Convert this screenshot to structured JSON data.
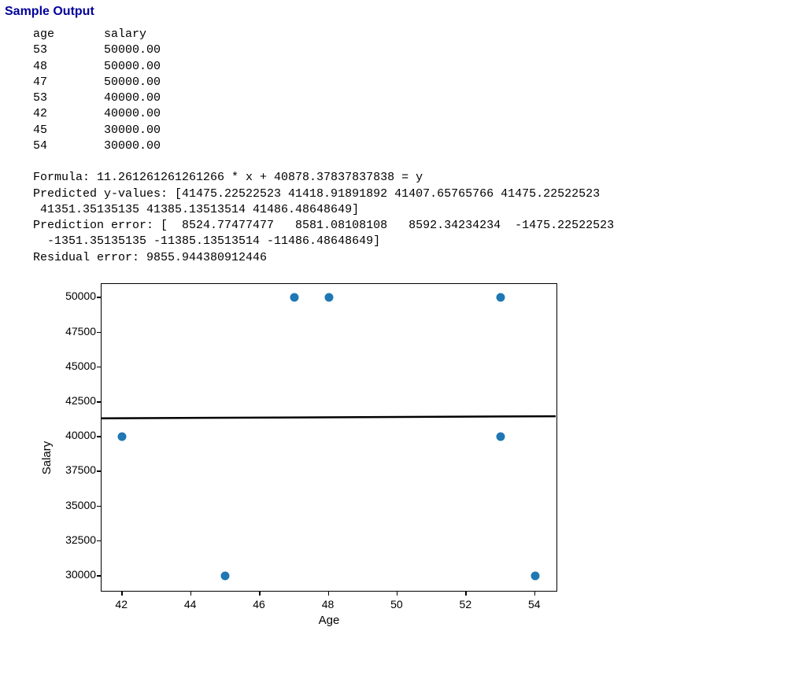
{
  "section_title": "Sample Output",
  "table": {
    "header": {
      "col1": "age",
      "col2": "salary"
    },
    "rows": [
      {
        "age": "53",
        "salary": "50000.00"
      },
      {
        "age": "48",
        "salary": "50000.00"
      },
      {
        "age": "47",
        "salary": "50000.00"
      },
      {
        "age": "53",
        "salary": "40000.00"
      },
      {
        "age": "42",
        "salary": "40000.00"
      },
      {
        "age": "45",
        "salary": "30000.00"
      },
      {
        "age": "54",
        "salary": "30000.00"
      }
    ]
  },
  "text": {
    "formula_line": "Formula: 11.261261261261266 * x + 40878.37837837838 = y",
    "predicted_line1": "Predicted y-values: [41475.22522523 41418.91891892 41407.65765766 41475.22522523",
    "predicted_line2": " 41351.35135135 41385.13513514 41486.48648649]",
    "error_line1": "Prediction error: [  8524.77477477   8581.08108108   8592.34234234  -1475.22522523",
    "error_line2": "  -1351.35135135 -11385.13513514 -11486.48648649]",
    "residual_line": "Residual error: 9855.944380912446"
  },
  "chart_data": {
    "type": "scatter",
    "title": "",
    "xlabel": "Age",
    "ylabel": "Salary",
    "xlim": [
      41.4,
      54.6
    ],
    "ylim": [
      29000,
      51000
    ],
    "xticks": [
      42,
      44,
      46,
      48,
      50,
      52,
      54
    ],
    "yticks": [
      30000,
      32500,
      35000,
      37500,
      40000,
      42500,
      45000,
      47500,
      50000
    ],
    "series": [
      {
        "name": "data",
        "type": "scatter",
        "points": [
          {
            "x": 53,
            "y": 50000
          },
          {
            "x": 48,
            "y": 50000
          },
          {
            "x": 47,
            "y": 50000
          },
          {
            "x": 53,
            "y": 40000
          },
          {
            "x": 42,
            "y": 40000
          },
          {
            "x": 45,
            "y": 30000
          },
          {
            "x": 54,
            "y": 30000
          }
        ],
        "color": "#1f77b4"
      },
      {
        "name": "regression",
        "type": "line",
        "slope": 11.261261261261266,
        "intercept": 40878.37837837838,
        "color": "#000000"
      }
    ]
  }
}
